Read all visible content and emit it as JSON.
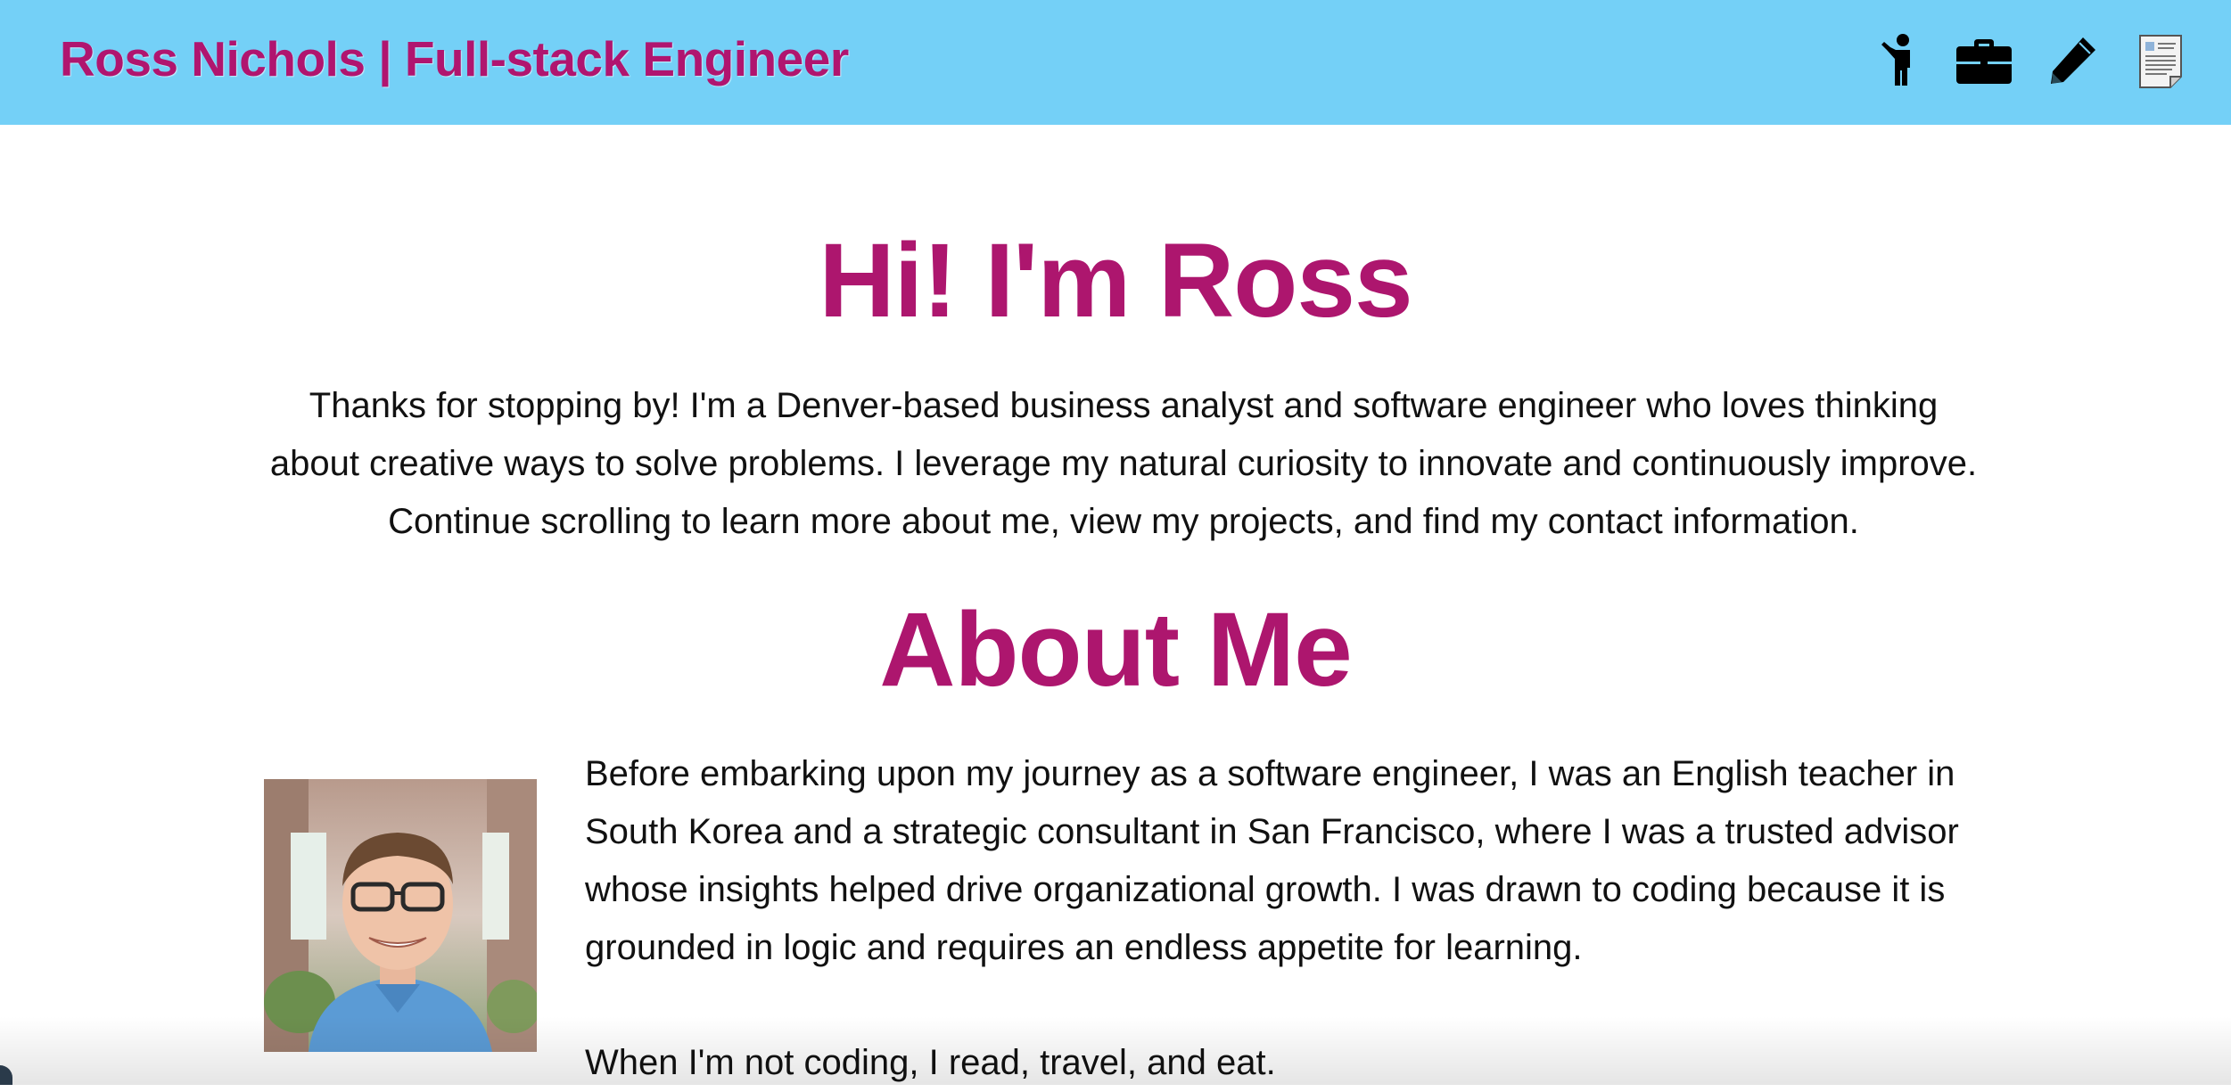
{
  "header": {
    "site_title": "Ross Nichols | Full-stack Engineer",
    "background": "#74d0f7",
    "title_color": "#b0156f",
    "nav": [
      {
        "icon": "person-pointing-icon",
        "target": "about"
      },
      {
        "icon": "briefcase-icon",
        "target": "projects"
      },
      {
        "icon": "pencil-icon",
        "target": "contact"
      },
      {
        "icon": "resume-document-icon",
        "target": "resume"
      }
    ]
  },
  "hero": {
    "title": "Hi! I'm Ross",
    "intro": "Thanks for stopping by! I'm a Denver-based business analyst and software engineer who loves thinking about creative ways to solve problems. I leverage my natural curiosity to innovate and continuously improve. Continue scrolling to learn more about me, view my projects, and find my contact information."
  },
  "about": {
    "title": "About Me",
    "paragraph1": "Before embarking upon my journey as a software engineer, I was an English teacher in South Korea and a strategic consultant in San Francisco, where I was a trusted advisor whose insights helped drive organizational growth. I was drawn to coding because it is grounded in logic and requires an endless appetite for learning.",
    "paragraph2": "When I'm not coding, I read, travel, and eat.",
    "avatar_icon": "profile-photo"
  },
  "colors": {
    "accent": "#ad166e",
    "text": "#111111"
  }
}
